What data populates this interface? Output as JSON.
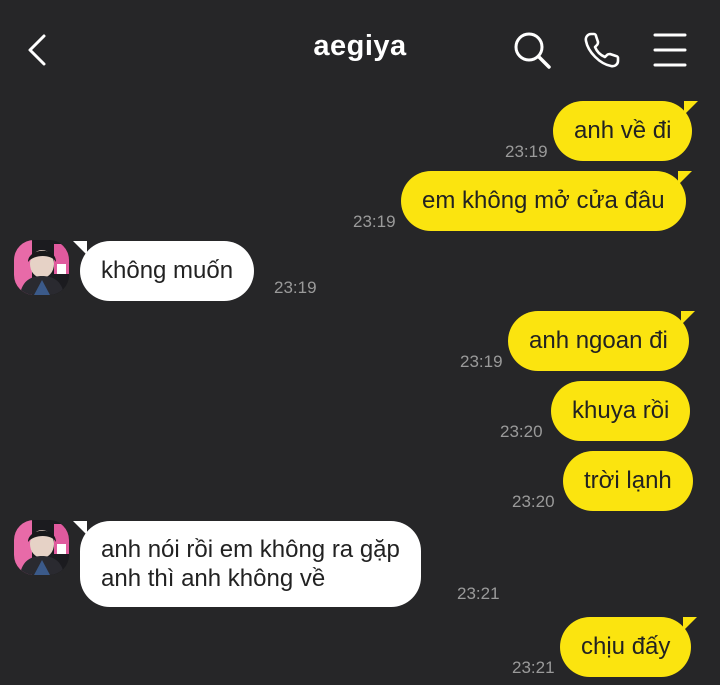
{
  "header": {
    "title": "aegiya",
    "icons": [
      "chevron-left-icon",
      "search-icon",
      "phone-icon",
      "menu-icon"
    ]
  },
  "colors": {
    "background": "#262628",
    "outgoing_bubble": "#fbe40f",
    "incoming_bubble": "#ffffff",
    "timestamp": "#9a9a9a"
  },
  "messages": [
    {
      "direction": "out",
      "text": "anh về đi",
      "time": "23:19"
    },
    {
      "direction": "out",
      "text": "em không mở cửa đâu",
      "time": "23:19"
    },
    {
      "direction": "in",
      "text": "không muốn",
      "time": "23:19"
    },
    {
      "direction": "out",
      "text": "anh ngoan đi",
      "time": "23:19"
    },
    {
      "direction": "out",
      "text": "khuya rồi",
      "time": "23:20"
    },
    {
      "direction": "out",
      "text": "trời lạnh",
      "time": "23:20"
    },
    {
      "direction": "in",
      "line1": "anh nói rồi em không ra gặp",
      "line2": "anh thì anh không về",
      "time": "23:21"
    },
    {
      "direction": "out",
      "text": "chịu đấy",
      "time": "23:21"
    }
  ]
}
